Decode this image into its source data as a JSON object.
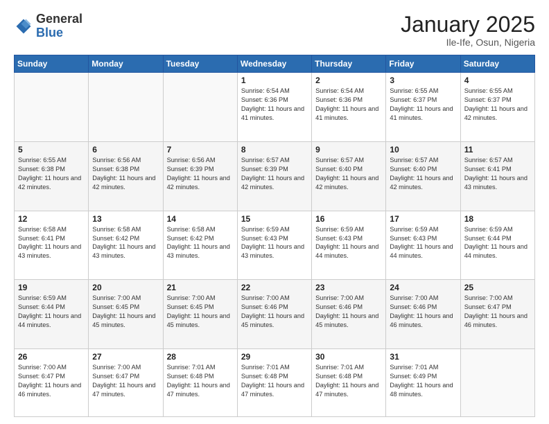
{
  "header": {
    "logo_general": "General",
    "logo_blue": "Blue",
    "title": "January 2025",
    "subtitle": "Ile-Ife, Osun, Nigeria"
  },
  "days_of_week": [
    "Sunday",
    "Monday",
    "Tuesday",
    "Wednesday",
    "Thursday",
    "Friday",
    "Saturday"
  ],
  "weeks": [
    [
      {
        "day": "",
        "info": ""
      },
      {
        "day": "",
        "info": ""
      },
      {
        "day": "",
        "info": ""
      },
      {
        "day": "1",
        "info": "Sunrise: 6:54 AM\nSunset: 6:36 PM\nDaylight: 11 hours and 41 minutes."
      },
      {
        "day": "2",
        "info": "Sunrise: 6:54 AM\nSunset: 6:36 PM\nDaylight: 11 hours and 41 minutes."
      },
      {
        "day": "3",
        "info": "Sunrise: 6:55 AM\nSunset: 6:37 PM\nDaylight: 11 hours and 41 minutes."
      },
      {
        "day": "4",
        "info": "Sunrise: 6:55 AM\nSunset: 6:37 PM\nDaylight: 11 hours and 42 minutes."
      }
    ],
    [
      {
        "day": "5",
        "info": "Sunrise: 6:55 AM\nSunset: 6:38 PM\nDaylight: 11 hours and 42 minutes."
      },
      {
        "day": "6",
        "info": "Sunrise: 6:56 AM\nSunset: 6:38 PM\nDaylight: 11 hours and 42 minutes."
      },
      {
        "day": "7",
        "info": "Sunrise: 6:56 AM\nSunset: 6:39 PM\nDaylight: 11 hours and 42 minutes."
      },
      {
        "day": "8",
        "info": "Sunrise: 6:57 AM\nSunset: 6:39 PM\nDaylight: 11 hours and 42 minutes."
      },
      {
        "day": "9",
        "info": "Sunrise: 6:57 AM\nSunset: 6:40 PM\nDaylight: 11 hours and 42 minutes."
      },
      {
        "day": "10",
        "info": "Sunrise: 6:57 AM\nSunset: 6:40 PM\nDaylight: 11 hours and 42 minutes."
      },
      {
        "day": "11",
        "info": "Sunrise: 6:57 AM\nSunset: 6:41 PM\nDaylight: 11 hours and 43 minutes."
      }
    ],
    [
      {
        "day": "12",
        "info": "Sunrise: 6:58 AM\nSunset: 6:41 PM\nDaylight: 11 hours and 43 minutes."
      },
      {
        "day": "13",
        "info": "Sunrise: 6:58 AM\nSunset: 6:42 PM\nDaylight: 11 hours and 43 minutes."
      },
      {
        "day": "14",
        "info": "Sunrise: 6:58 AM\nSunset: 6:42 PM\nDaylight: 11 hours and 43 minutes."
      },
      {
        "day": "15",
        "info": "Sunrise: 6:59 AM\nSunset: 6:43 PM\nDaylight: 11 hours and 43 minutes."
      },
      {
        "day": "16",
        "info": "Sunrise: 6:59 AM\nSunset: 6:43 PM\nDaylight: 11 hours and 44 minutes."
      },
      {
        "day": "17",
        "info": "Sunrise: 6:59 AM\nSunset: 6:43 PM\nDaylight: 11 hours and 44 minutes."
      },
      {
        "day": "18",
        "info": "Sunrise: 6:59 AM\nSunset: 6:44 PM\nDaylight: 11 hours and 44 minutes."
      }
    ],
    [
      {
        "day": "19",
        "info": "Sunrise: 6:59 AM\nSunset: 6:44 PM\nDaylight: 11 hours and 44 minutes."
      },
      {
        "day": "20",
        "info": "Sunrise: 7:00 AM\nSunset: 6:45 PM\nDaylight: 11 hours and 45 minutes."
      },
      {
        "day": "21",
        "info": "Sunrise: 7:00 AM\nSunset: 6:45 PM\nDaylight: 11 hours and 45 minutes."
      },
      {
        "day": "22",
        "info": "Sunrise: 7:00 AM\nSunset: 6:46 PM\nDaylight: 11 hours and 45 minutes."
      },
      {
        "day": "23",
        "info": "Sunrise: 7:00 AM\nSunset: 6:46 PM\nDaylight: 11 hours and 45 minutes."
      },
      {
        "day": "24",
        "info": "Sunrise: 7:00 AM\nSunset: 6:46 PM\nDaylight: 11 hours and 46 minutes."
      },
      {
        "day": "25",
        "info": "Sunrise: 7:00 AM\nSunset: 6:47 PM\nDaylight: 11 hours and 46 minutes."
      }
    ],
    [
      {
        "day": "26",
        "info": "Sunrise: 7:00 AM\nSunset: 6:47 PM\nDaylight: 11 hours and 46 minutes."
      },
      {
        "day": "27",
        "info": "Sunrise: 7:00 AM\nSunset: 6:47 PM\nDaylight: 11 hours and 47 minutes."
      },
      {
        "day": "28",
        "info": "Sunrise: 7:01 AM\nSunset: 6:48 PM\nDaylight: 11 hours and 47 minutes."
      },
      {
        "day": "29",
        "info": "Sunrise: 7:01 AM\nSunset: 6:48 PM\nDaylight: 11 hours and 47 minutes."
      },
      {
        "day": "30",
        "info": "Sunrise: 7:01 AM\nSunset: 6:48 PM\nDaylight: 11 hours and 47 minutes."
      },
      {
        "day": "31",
        "info": "Sunrise: 7:01 AM\nSunset: 6:49 PM\nDaylight: 11 hours and 48 minutes."
      },
      {
        "day": "",
        "info": ""
      }
    ]
  ]
}
